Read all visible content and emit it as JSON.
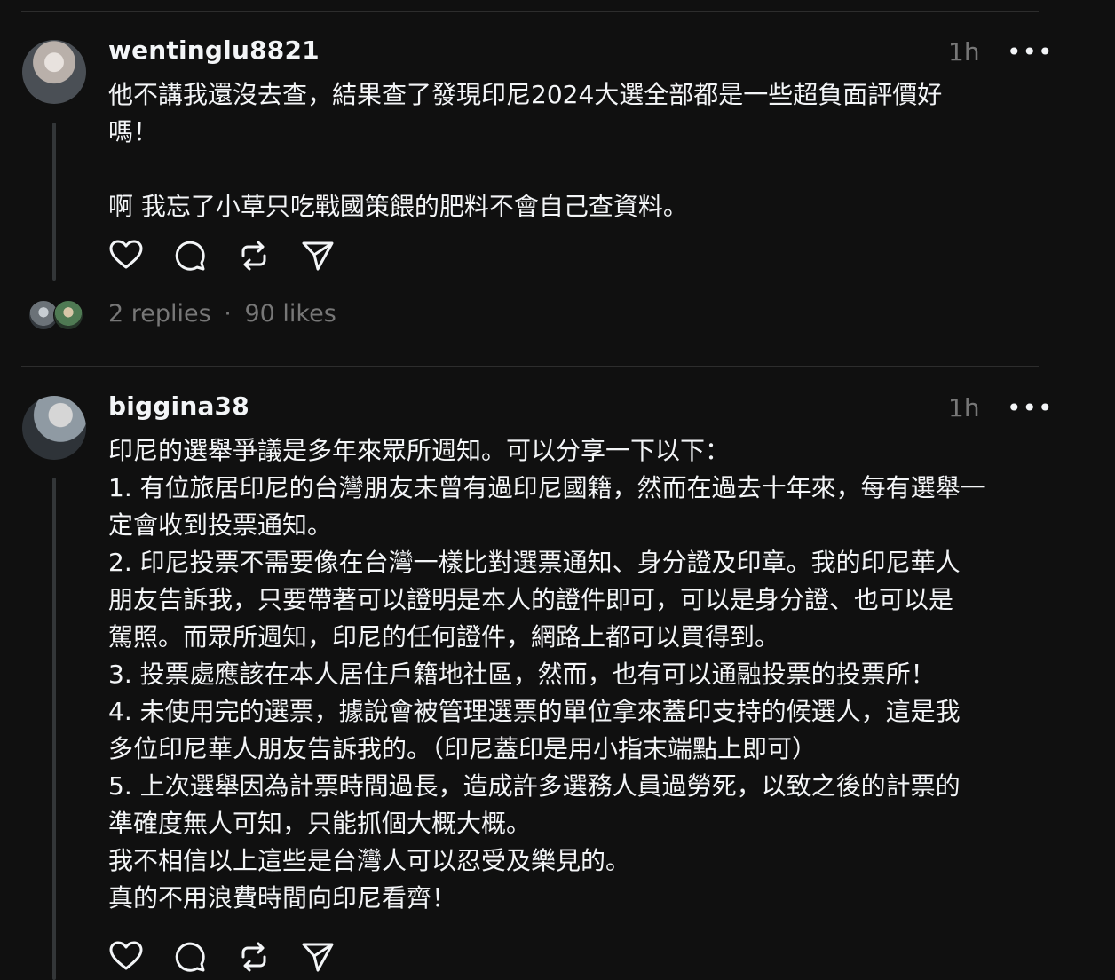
{
  "posts": [
    {
      "username": "wentinglu8821",
      "time": "1h",
      "more": "•••",
      "body": "他不講我還沒去查，結果查了發現印尼2024大選全部都是一些超負面評價好\n嗎！\n\n啊 我忘了小草只吃戰國策餵的肥料不會自己查資料。",
      "replies": "2 replies",
      "separator": "·",
      "likes": "90 likes"
    },
    {
      "username": "biggina38",
      "time": "1h",
      "more": "•••",
      "body": "印尼的選舉爭議是多年來眾所週知。可以分享一下以下：\n1. 有位旅居印尼的台灣朋友未曾有過印尼國籍，然而在過去十年來，每有選舉一\n定會收到投票通知。\n2. 印尼投票不需要像在台灣一樣比對選票通知、身分證及印章。我的印尼華人\n朋友告訴我，只要帶著可以證明是本人的證件即可，可以是身分證、也可以是\n駕照。而眾所週知，印尼的任何證件，網路上都可以買得到。\n3. 投票處應該在本人居住戶籍地社區，然而，也有可以通融投票的投票所！\n4. 未使用完的選票，據說會被管理選票的單位拿來蓋印支持的候選人，這是我\n多位印尼華人朋友告訴我的。（印尼蓋印是用小指末端點上即可）\n5. 上次選舉因為計票時間過長，造成許多選務人員過勞死，以致之後的計票的\n準確度無人可知，只能抓個大概大概。\n我不相信以上這些是台灣人可以忍受及樂見的。\n真的不用浪費時間向印尼看齊！"
    }
  ],
  "icons": {
    "like": "heart-icon",
    "comment": "comment-icon",
    "repost": "repost-icon",
    "share": "share-icon"
  }
}
